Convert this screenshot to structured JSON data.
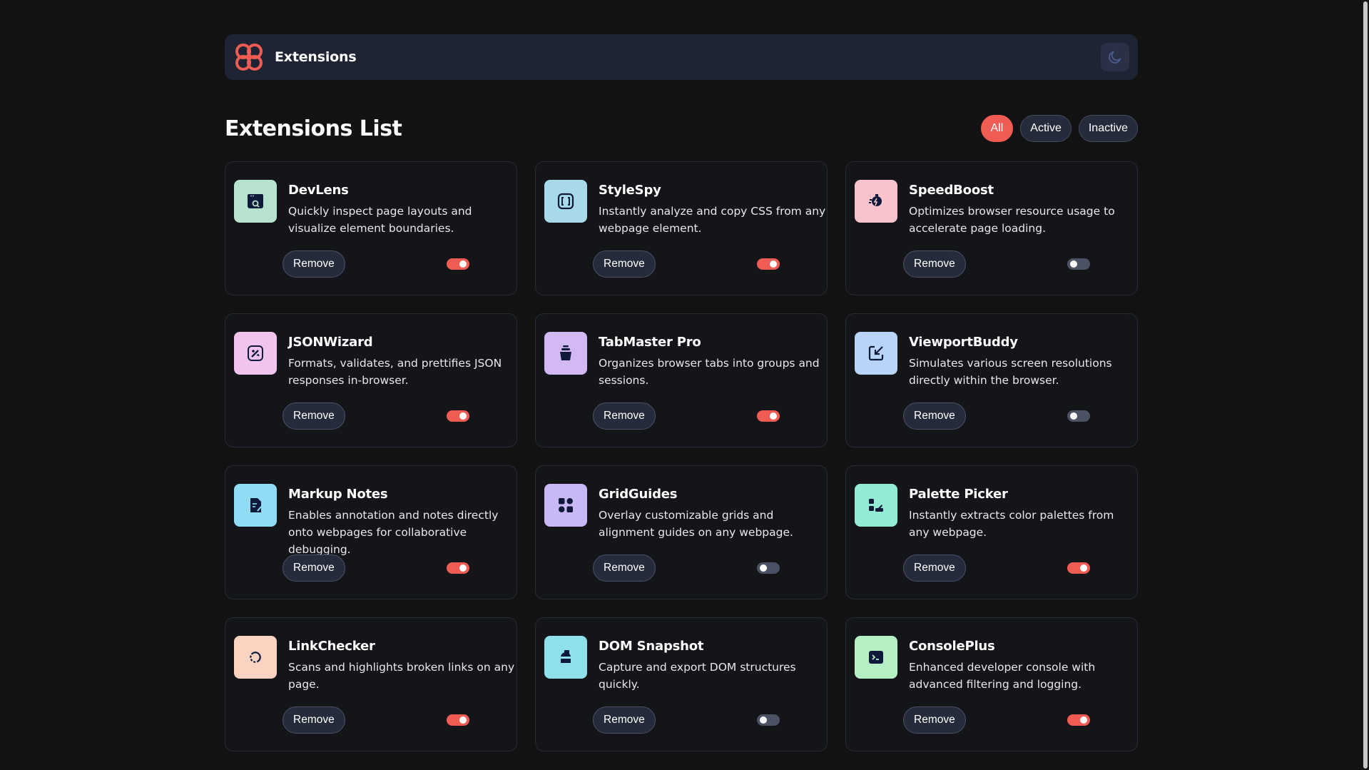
{
  "header": {
    "title": "Extensions",
    "theme_icon": "moon-icon",
    "logo_color": "#f05c53"
  },
  "list": {
    "title": "Extensions List"
  },
  "filters": [
    {
      "label": "All",
      "active": true
    },
    {
      "label": "Active",
      "active": false
    },
    {
      "label": "Inactive",
      "active": false
    }
  ],
  "colors": {
    "accent": "#f05c53",
    "panel": "#1f2435",
    "background": "#121212"
  },
  "remove_label": "Remove",
  "extensions": [
    {
      "name": "DevLens",
      "description": "Quickly inspect page layouts and visualize element boundaries.",
      "enabled": true,
      "icon": "devlens-icon",
      "icon_bg": "#b7e2cf"
    },
    {
      "name": "StyleSpy",
      "description": "Instantly analyze and copy CSS from any webpage element.",
      "enabled": true,
      "icon": "stylespy-icon",
      "icon_bg": "#a8d9e9"
    },
    {
      "name": "SpeedBoost",
      "description": "Optimizes browser resource usage to accelerate page loading.",
      "enabled": false,
      "icon": "speedboost-icon",
      "icon_bg": "#f8c3cd"
    },
    {
      "name": "JSONWizard",
      "description": "Formats, validates, and prettifies JSON responses in-browser.",
      "enabled": true,
      "icon": "jsonwizard-icon",
      "icon_bg": "#f1c4ee"
    },
    {
      "name": "TabMaster Pro",
      "description": "Organizes browser tabs into groups and sessions.",
      "enabled": true,
      "icon": "tabmaster-icon",
      "icon_bg": "#d3b9f4"
    },
    {
      "name": "ViewportBuddy",
      "description": "Simulates various screen resolutions directly within the browser.",
      "enabled": false,
      "icon": "viewportbuddy-icon",
      "icon_bg": "#b8d4f8"
    },
    {
      "name": "Markup Notes",
      "description": "Enables annotation and notes directly onto webpages for collaborative debugging.",
      "enabled": true,
      "icon": "markupnotes-icon",
      "icon_bg": "#8fdcf4"
    },
    {
      "name": "GridGuides",
      "description": "Overlay customizable grids and alignment guides on any webpage.",
      "enabled": false,
      "icon": "gridguides-icon",
      "icon_bg": "#c9b8f6"
    },
    {
      "name": "Palette Picker",
      "description": "Instantly extracts color palettes from any webpage.",
      "enabled": true,
      "icon": "palettepicker-icon",
      "icon_bg": "#93ebd6"
    },
    {
      "name": "LinkChecker",
      "description": "Scans and highlights broken links on any page.",
      "enabled": true,
      "icon": "linkchecker-icon",
      "icon_bg": "#fcd2c0"
    },
    {
      "name": "DOM Snapshot",
      "description": "Capture and export DOM structures quickly.",
      "enabled": false,
      "icon": "domsnapshot-icon",
      "icon_bg": "#8ee0ea"
    },
    {
      "name": "ConsolePlus",
      "description": "Enhanced developer console with advanced filtering and logging.",
      "enabled": true,
      "icon": "consoleplus-icon",
      "icon_bg": "#b5f0c5"
    }
  ]
}
